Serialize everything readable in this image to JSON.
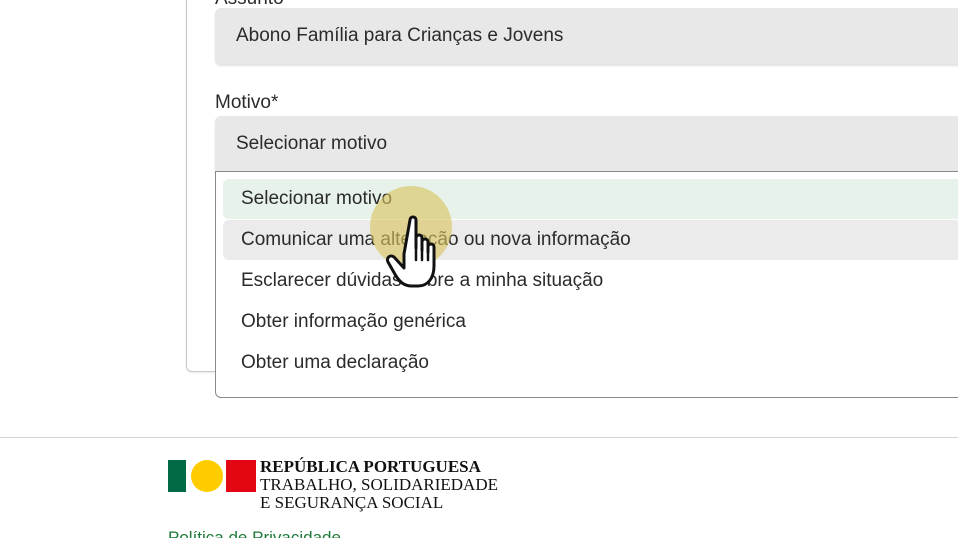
{
  "form": {
    "assunto": {
      "label": "Assunto",
      "value": "Abono Família para Crianças e Jovens"
    },
    "motivo": {
      "label": "Motivo*",
      "value": "Selecionar motivo",
      "options": [
        "Selecionar motivo",
        "Comunicar uma alteração ou nova informação",
        "Esclarecer dúvidas sobre a minha situação",
        "Obter informação genérica",
        "Obter uma declaração"
      ],
      "selected_index": 0,
      "hovered_index": 1
    }
  },
  "footer": {
    "logo": {
      "line1": "REPÚBLICA PORTUGUESA",
      "line2": "TRABALHO, SOLIDARIEDADE",
      "line3": "E SEGURANÇA SOCIAL",
      "colors": [
        "#006a44",
        "#ffcc00",
        "#e30613"
      ]
    },
    "links": [
      "Política de Privacidade"
    ]
  },
  "colors": {
    "selected_option_bg": "#e6f2ea",
    "hover_option_bg": "#ebebeb",
    "select_bg": "#e8e8e8",
    "link": "#1e7a3a"
  }
}
